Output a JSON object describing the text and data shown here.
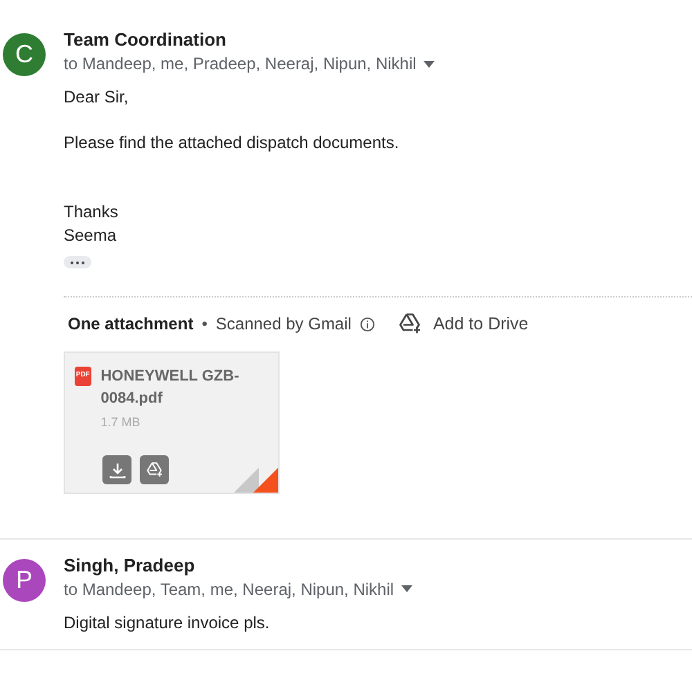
{
  "messages": [
    {
      "avatar_letter": "C",
      "color": "#2e7d32",
      "sender": "Team Coordination",
      "to": "to Mandeep, me, Pradeep, Neeraj, Nipun, Nikhil",
      "body": [
        {
          "kind": "text",
          "lines": [
            "Dear Sir,"
          ]
        },
        {
          "kind": "text",
          "lines": [
            "Please find the attached dispatch documents."
          ]
        },
        {
          "kind": "signature",
          "lines": [
            "Thanks",
            "Seema"
          ]
        }
      ],
      "show_trimmed": true,
      "attachments": {
        "title": "One attachment",
        "separator": "•",
        "scanned": "Scanned by Gmail",
        "add_all": "Add to Drive",
        "files": [
          {
            "badge": "PDF",
            "name": "HONEYWELL GZB-0084.pdf",
            "size": "1.7 MB"
          }
        ]
      }
    },
    {
      "avatar_letter": "P",
      "color": "#ab47bc",
      "sender": "Singh, Pradeep",
      "to": "to Mandeep, Team, me, Neeraj, Nipun, Nikhil",
      "body": [
        {
          "kind": "text",
          "lines": [
            "Digital signature invoice pls."
          ]
        }
      ]
    }
  ]
}
